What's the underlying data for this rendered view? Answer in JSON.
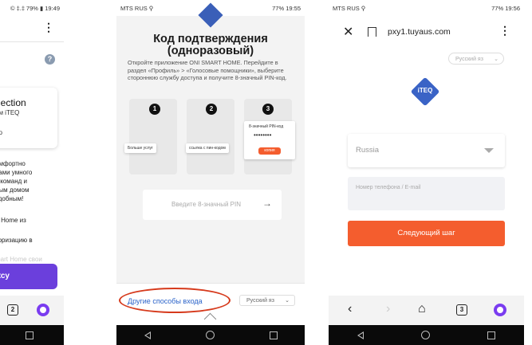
{
  "panel1": {
    "status": {
      "right": "© ‡.‡ 79% ▮ 19:49"
    },
    "card": {
      "title": "nection",
      "line1": "ом iTEQ",
      "line2": "ер"
    },
    "body_lines": [
      "омфортно",
      "вами умного",
      "х команд и",
      "ным домом",
      "удобным!"
    ],
    "line_smart": "rt Home из",
    "line_auth": "торизацию в",
    "line_faded": "mart Home свои",
    "button": "ксу",
    "tab_count": "2"
  },
  "panel2": {
    "status": {
      "left": "MTS RUS",
      "right": "77% 19:55"
    },
    "title": "Код подтверждения (одноразовый)",
    "description": "Откройте приложение ONI SMART HOME. Перейдите в раздел «Профиль» > «Голосовые помощники», выберите стороннюю службу доступа и получите 8-значный PIN-код.",
    "steps": [
      "1",
      "2",
      "3"
    ],
    "step1_pop": "Больше услуг",
    "step2_pop": "ссылка с пин-кодом",
    "step3_label": "8-значный PIN-код",
    "step3_dots": "••••••••",
    "step3_btn": "копия",
    "pin_placeholder": "Введите 8-значный PIN",
    "other_link": "Другие способы входа",
    "language": "Русский яз"
  },
  "panel3": {
    "status": {
      "left": "MTS RUS",
      "right": "77% 19:56"
    },
    "url": "pxy1.tuyaus.com",
    "language": "Русский яз",
    "logo": "iTEQ",
    "country": "Russia",
    "phone_placeholder": "Номер телефона / E-mail",
    "next_button": "Следующий шаг",
    "tab_count": "3"
  },
  "colors": {
    "accent_orange": "#f45d2e",
    "alice_purple": "#7a3cf0",
    "highlight_red": "#d63a1c",
    "link_blue": "#2b63c9"
  }
}
